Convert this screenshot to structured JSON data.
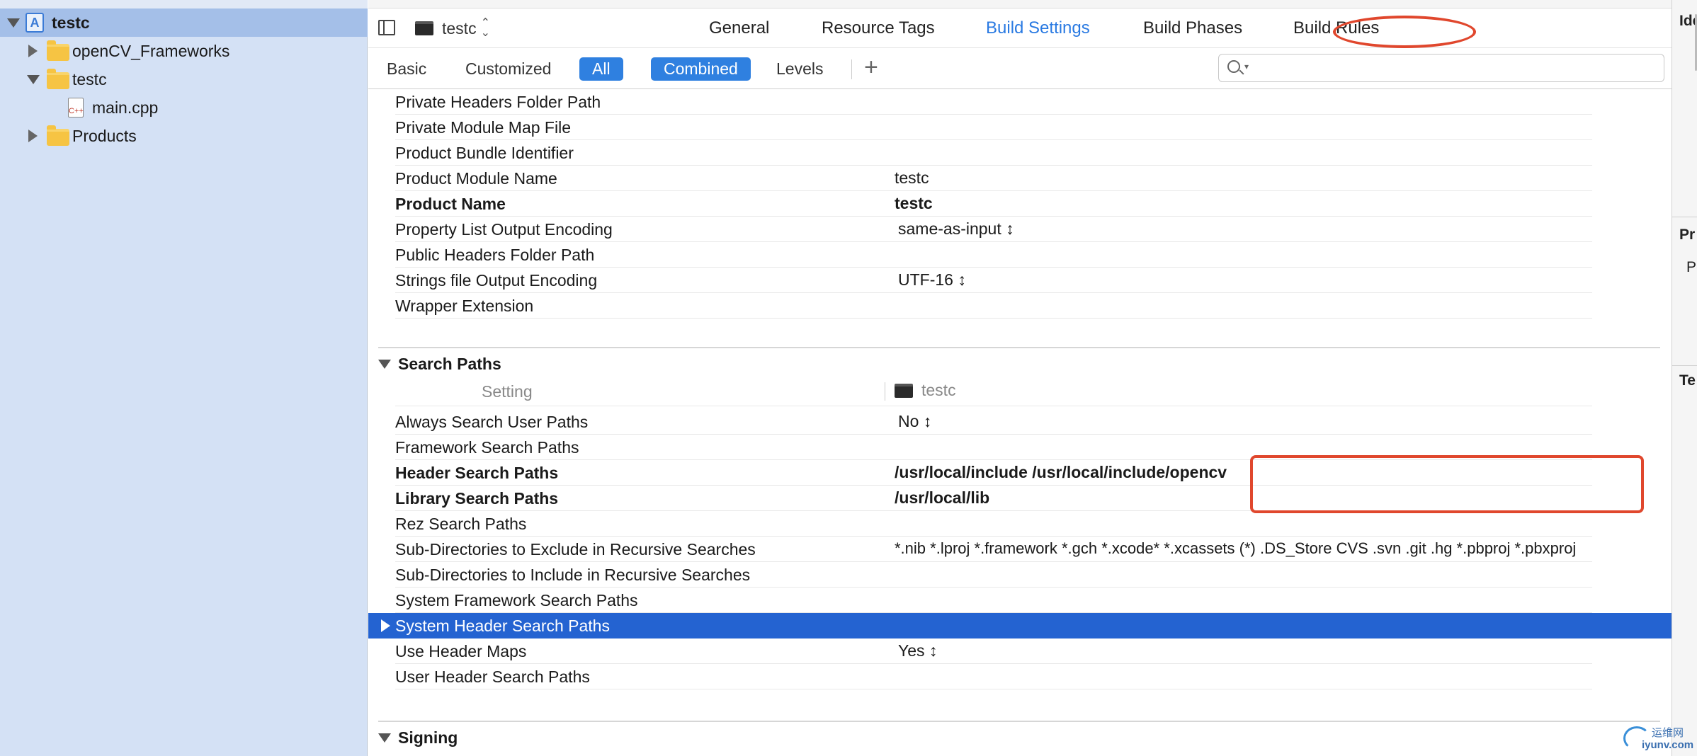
{
  "navigator": {
    "items": [
      {
        "label": "testc",
        "kind": "project",
        "expanded": true,
        "selected": true
      },
      {
        "label": "openCV_Frameworks",
        "kind": "folder",
        "expanded": false
      },
      {
        "label": "testc",
        "kind": "folder",
        "expanded": true
      },
      {
        "label": "main.cpp",
        "kind": "cpp-file"
      },
      {
        "label": "Products",
        "kind": "folder",
        "expanded": false
      }
    ]
  },
  "header": {
    "target_name": "testc",
    "tabs": [
      "General",
      "Resource Tags",
      "Build Settings",
      "Build Phases",
      "Build Rules"
    ],
    "active_tab": "Build Settings"
  },
  "filter": {
    "scope": [
      "Basic",
      "Customized",
      "All"
    ],
    "scope_selected": "All",
    "view": [
      "Combined",
      "Levels"
    ],
    "view_selected": "Combined",
    "add_label": "+",
    "search_value": ""
  },
  "packaging_rows": [
    {
      "name": "Private Headers Folder Path",
      "value": ""
    },
    {
      "name": "Private Module Map File",
      "value": ""
    },
    {
      "name": "Product Bundle Identifier",
      "value": ""
    },
    {
      "name": "Product Module Name",
      "value": "testc"
    },
    {
      "name": "Product Name",
      "value": "testc",
      "bold": true
    },
    {
      "name": "Property List Output Encoding",
      "value": "same-as-input ↕"
    },
    {
      "name": "Public Headers Folder Path",
      "value": ""
    },
    {
      "name": "Strings file Output Encoding",
      "value": "UTF-16 ↕"
    },
    {
      "name": "Wrapper Extension",
      "value": ""
    }
  ],
  "search_paths": {
    "title": "Search Paths",
    "column_setting": "Setting",
    "column_target": "testc",
    "rows": [
      {
        "name": "Always Search User Paths",
        "value": "No ↕"
      },
      {
        "name": "Framework Search Paths",
        "value": ""
      },
      {
        "name": "Header Search Paths",
        "value": "/usr/local/include /usr/local/include/opencv",
        "bold": true
      },
      {
        "name": "Library Search Paths",
        "value": "/usr/local/lib",
        "bold": true
      },
      {
        "name": "Rez Search Paths",
        "value": ""
      },
      {
        "name": "Sub-Directories to Exclude in Recursive Searches",
        "value": "*.nib *.lproj *.framework *.gch *.xcode* *.xcassets (*) .DS_Store CVS .svn .git .hg *.pbproj *.pbxproj"
      },
      {
        "name": "Sub-Directories to Include in Recursive Searches",
        "value": ""
      },
      {
        "name": "System Framework Search Paths",
        "value": ""
      },
      {
        "name": "System Header Search Paths",
        "value": "",
        "selected": true
      },
      {
        "name": "Use Header Maps",
        "value": "Yes ↕"
      },
      {
        "name": "User Header Search Paths",
        "value": ""
      }
    ]
  },
  "signing": {
    "title": "Signing"
  },
  "inspector": {
    "labels": [
      "Ide",
      "Pr",
      "Pr",
      "Te"
    ]
  },
  "watermark": {
    "cn": "运维网",
    "url": "iyunv.com"
  },
  "colors": {
    "accent": "#2f80e0",
    "selection": "#2463d1",
    "navigator_bg": "#d4e1f5",
    "annotation": "#e0472d"
  }
}
